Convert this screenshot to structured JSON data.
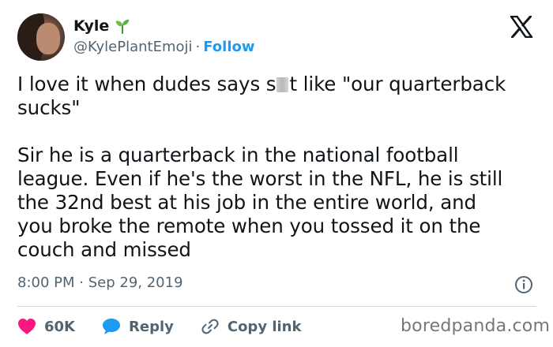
{
  "author": {
    "name": "Kyle",
    "handle": "@KylePlantEmoji",
    "separator": "·",
    "follow_label": "Follow",
    "avatar_icon": "profile-photo",
    "emoji_icon": "seedling-icon"
  },
  "tweet": {
    "line1_before": "I love it when dudes says s",
    "line1_after": "t like \"our quarterback\nsucks\"",
    "body": "Sir he is a quarterback in the national football\nleague. Even if he's the worst in the NFL, he is still\nthe 32nd best at his job in the entire world, and\nyou broke the remote when you tossed it on the\ncouch and missed",
    "time": "8:00 PM",
    "date_separator": "·",
    "date": "Sep 29, 2019"
  },
  "actions": {
    "likes": "60K",
    "reply_label": "Reply",
    "copy_link_label": "Copy link"
  },
  "watermark": "boredpanda.com",
  "colors": {
    "accent": "#1d9bf0",
    "like": "#f91880",
    "text": "#0f1419",
    "secondary": "#536471"
  }
}
